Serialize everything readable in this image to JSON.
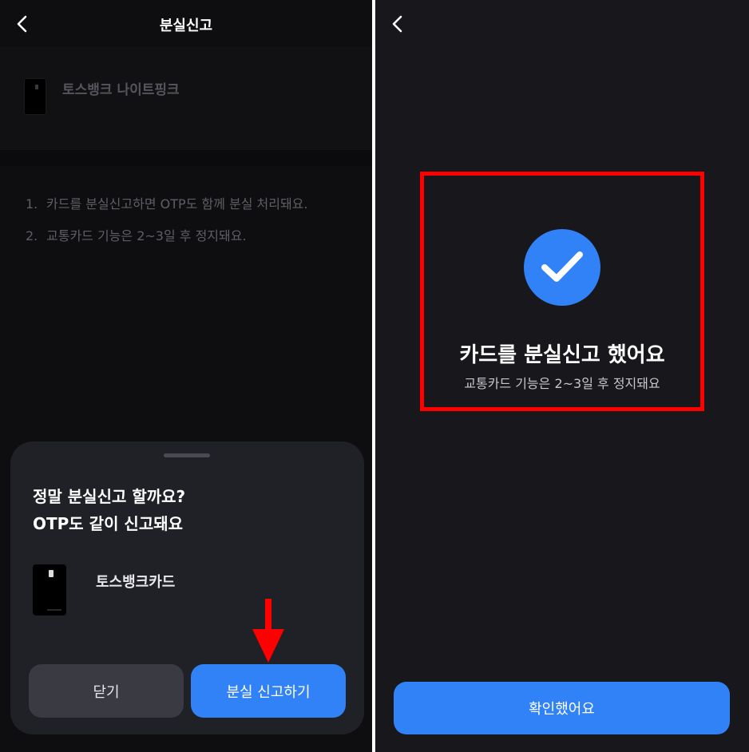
{
  "left": {
    "header_title": "분실신고",
    "card_name": "토스뱅크 나이트핑크",
    "notices": [
      {
        "num": "1.",
        "text": "카드를 분실신고하면 OTP도 함께 분실 처리돼요."
      },
      {
        "num": "2.",
        "text": "교통카드 기능은 2~3일 후 정지돼요."
      }
    ],
    "sheet": {
      "title_line1": "정말 분실신고 할까요?",
      "title_line2": "OTP도 같이 신고돼요",
      "card_name": "토스뱅크카드",
      "close_label": "닫기",
      "report_label": "분실 신고하기"
    }
  },
  "right": {
    "title": "카드를 분실신고 했어요",
    "subtitle": "교통카드 기능은 2~3일 후 정지돼요",
    "confirm_label": "확인했어요"
  },
  "colors": {
    "accent": "#3182f6",
    "annotation": "#ff0000"
  },
  "icons": [
    "back-icon",
    "check-icon",
    "arrow-down-icon"
  ]
}
